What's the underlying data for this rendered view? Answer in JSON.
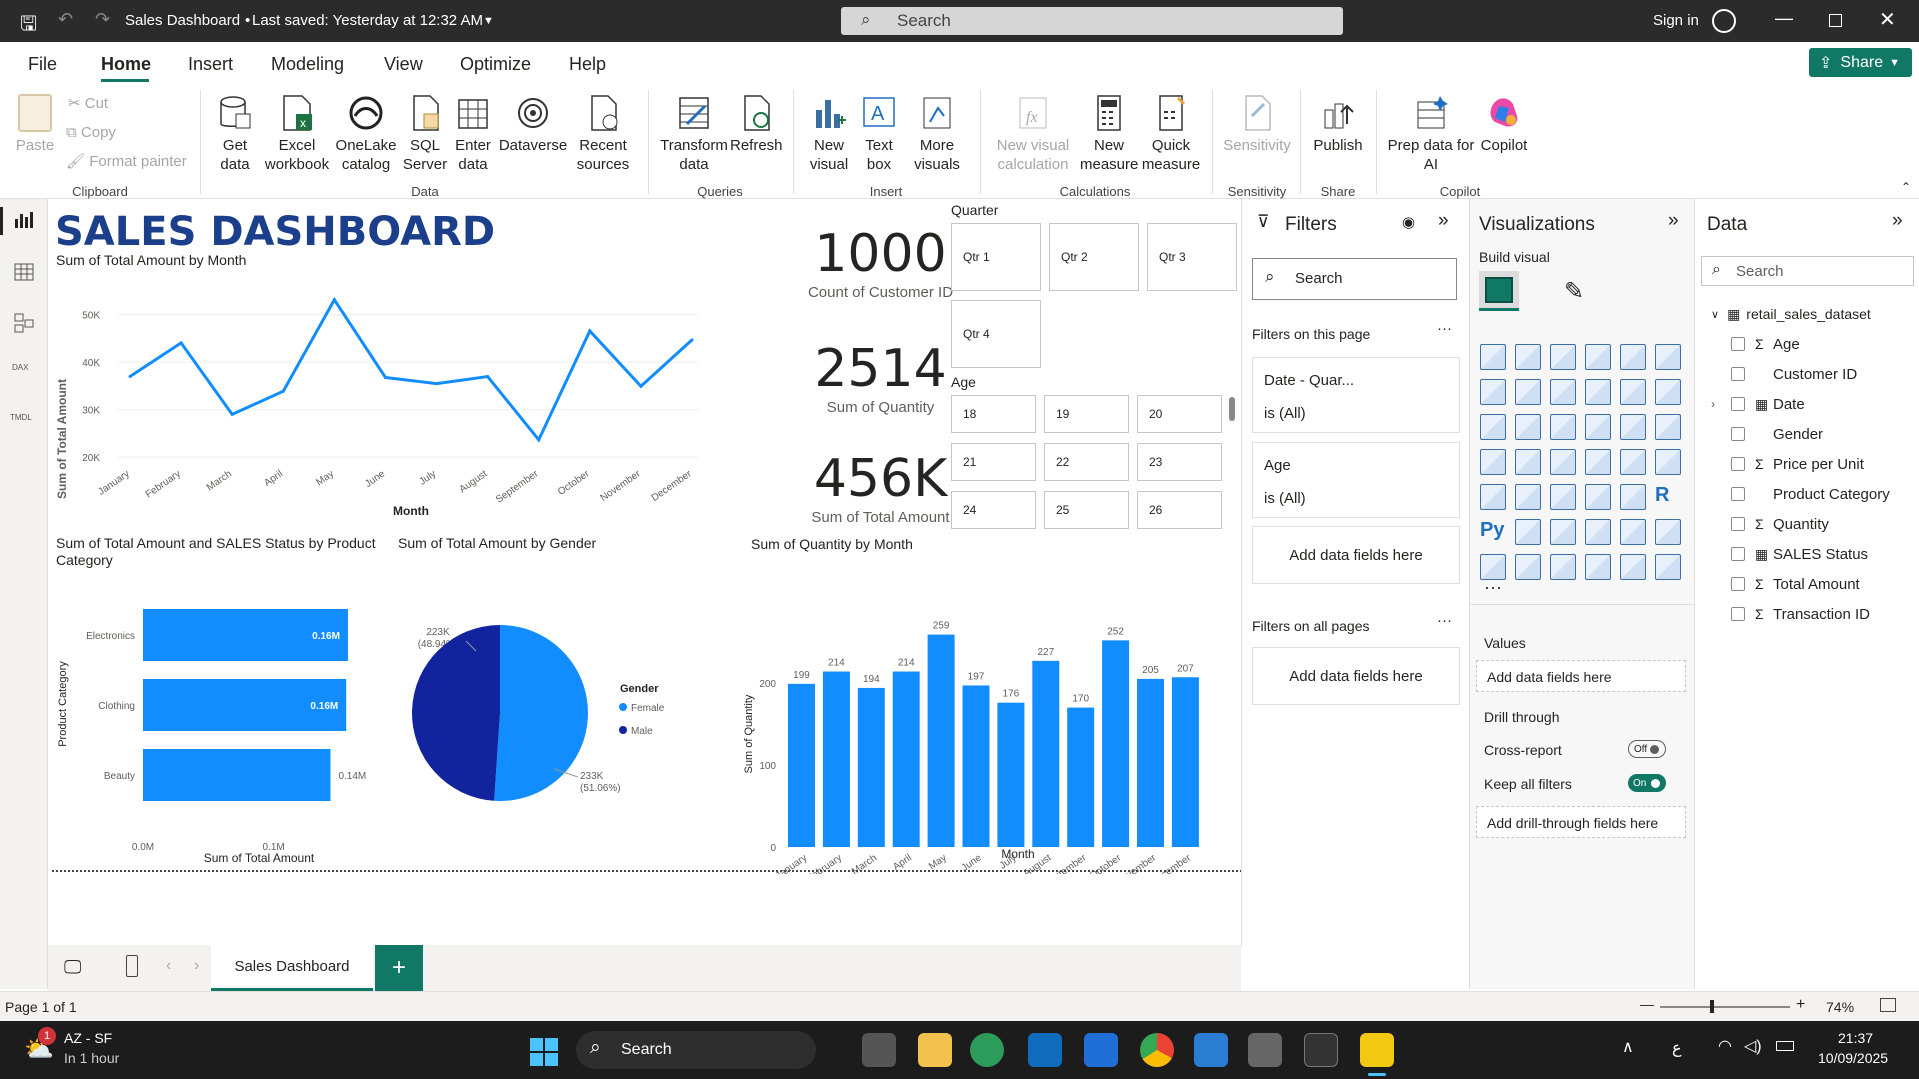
{
  "titlebar": {
    "title": "Sales Dashboard",
    "saved": "Last saved: Yesterday at 12:32 AM",
    "search": "Search",
    "signin": "Sign in"
  },
  "menu": {
    "items": [
      "File",
      "Home",
      "Insert",
      "Modeling",
      "View",
      "Optimize",
      "Help"
    ],
    "share": "Share"
  },
  "ribbon": {
    "clipboard": {
      "paste": "Paste",
      "cut": "Cut",
      "copy": "Copy",
      "format": "Format painter",
      "group": "Clipboard"
    },
    "data": {
      "get": "Get data",
      "excel": "Excel workbook",
      "onelake": "OneLake catalog",
      "sql": "SQL Server",
      "enter": "Enter data",
      "dataverse": "Dataverse",
      "recent": "Recent sources",
      "group": "Data"
    },
    "queries": {
      "transform": "Transform data",
      "refresh": "Refresh",
      "group": "Queries"
    },
    "insert": {
      "newvisual": "New visual",
      "textbox": "Text box",
      "morevisuals": "More visuals",
      "group": "Insert"
    },
    "calc": {
      "newcalc": "New visual calculation",
      "newmeasure": "New measure",
      "quick": "Quick measure",
      "group": "Calculations"
    },
    "sens": {
      "label": "Sensitivity",
      "group": "Sensitivity"
    },
    "share": {
      "publish": "Publish",
      "group": "Share"
    },
    "copilot": {
      "prep": "Prep data for AI",
      "copilot": "Copilot",
      "group": "Copilot"
    }
  },
  "dashboard": {
    "title": "SALES DASHBOARD",
    "line": {
      "title": "Sum of Total Amount by Month",
      "ylabel": "Sum of Total Amount",
      "xlabel": "Month"
    },
    "kpis": [
      {
        "value": "1000",
        "label": "Count of Customer ID"
      },
      {
        "value": "2514",
        "label": "Sum of Quantity"
      },
      {
        "value": "456K",
        "label": "Sum of Total Amount"
      }
    ],
    "quarter": {
      "title": "Quarter",
      "items": [
        "Qtr 1",
        "Qtr 2",
        "Qtr 3",
        "Qtr 4"
      ]
    },
    "age": {
      "title": "Age",
      "items": [
        "18",
        "19",
        "20",
        "21",
        "22",
        "23",
        "24",
        "25",
        "26"
      ]
    },
    "hbar": {
      "title": "Sum of Total Amount and SALES Status by Product Category",
      "ylabel": "Product Category",
      "xlabel": "Sum of Total Amount"
    },
    "pie": {
      "title": "Sum of Total Amount by Gender",
      "legend_title": "Gender",
      "label_male": "223K",
      "label_male_pct": "(48.94%)",
      "label_female": "233K",
      "label_female_pct": "(51.06%)"
    },
    "vbar": {
      "title": "Sum of Quantity by Month",
      "ylabel": "Sum of Quantity",
      "xlabel": "Month"
    }
  },
  "chart_data": [
    {
      "type": "line",
      "title": "Sum of Total Amount by Month",
      "xlabel": "Month",
      "ylabel": "Sum of Total Amount",
      "categories": [
        "January",
        "February",
        "March",
        "April",
        "May",
        "June",
        "July",
        "August",
        "September",
        "October",
        "November",
        "December"
      ],
      "values": [
        36980,
        44060,
        28990,
        33870,
        53150,
        36770,
        35465,
        36960,
        23620,
        46580,
        34920,
        44690
      ],
      "yticks": [
        "20K",
        "30K",
        "40K",
        "50K"
      ],
      "ylim": [
        20000,
        55000
      ]
    },
    {
      "type": "bar",
      "orientation": "horizontal",
      "title": "Sum of Total Amount and SALES Status by Product Category",
      "xlabel": "Sum of Total Amount",
      "ylabel": "Product Category",
      "categories": [
        "Electronics",
        "Clothing",
        "Beauty"
      ],
      "values": [
        156905,
        155580,
        143515
      ],
      "data_labels": [
        "0.16M",
        "0.16M",
        "0.14M"
      ],
      "xticks": [
        "0.0M",
        "0.1M"
      ],
      "xlim": [
        0,
        0.2
      ]
    },
    {
      "type": "pie",
      "title": "Sum of Total Amount by Gender",
      "series": [
        {
          "name": "Female",
          "value": 232840,
          "label": "233K",
          "pct": "(51.06%)",
          "color": "#118DFF"
        },
        {
          "name": "Male",
          "value": 223160,
          "label": "223K",
          "pct": "(48.94%)",
          "color": "#12239E"
        }
      ]
    },
    {
      "type": "bar",
      "title": "Sum of Quantity by Month",
      "xlabel": "Month",
      "ylabel": "Sum of Quantity",
      "categories": [
        "January",
        "February",
        "March",
        "April",
        "May",
        "June",
        "July",
        "August",
        "September",
        "October",
        "November",
        "December"
      ],
      "values": [
        199,
        214,
        194,
        214,
        259,
        197,
        176,
        227,
        170,
        252,
        205,
        207
      ],
      "yticks": [
        "0",
        "100",
        "200"
      ],
      "ylim": [
        0,
        270
      ]
    }
  ],
  "filters": {
    "title": "Filters",
    "search": "Search",
    "on_page": "Filters on this page",
    "date_filter": "Date - Quar...",
    "date_value": "is (All)",
    "age_filter": "Age",
    "age_value": "is (All)",
    "add": "Add data fields here",
    "on_all": "Filters on all pages"
  },
  "viz": {
    "title": "Visualizations",
    "build": "Build visual",
    "values": "Values",
    "add_values": "Add data fields here",
    "drill": "Drill through",
    "cross": "Cross-report",
    "cross_state": "Off",
    "keep": "Keep all filters",
    "keep_state": "On",
    "add_drill": "Add drill-through fields here"
  },
  "data": {
    "title": "Data",
    "search": "Search",
    "table": "retail_sales_dataset",
    "fields": [
      {
        "name": "Age",
        "sigma": true
      },
      {
        "name": "Customer ID",
        "sigma": false
      },
      {
        "name": "Date",
        "sigma": false,
        "cal": true
      },
      {
        "name": "Gender",
        "sigma": false
      },
      {
        "name": "Price per Unit",
        "sigma": true
      },
      {
        "name": "Product Category",
        "sigma": false
      },
      {
        "name": "Quantity",
        "sigma": true
      },
      {
        "name": "SALES Status",
        "sigma": false,
        "cal": true
      },
      {
        "name": "Total Amount",
        "sigma": true
      },
      {
        "name": "Transaction ID",
        "sigma": true
      }
    ]
  },
  "tabs": {
    "page": "Sales Dashboard"
  },
  "status": {
    "page": "Page 1 of 1",
    "zoom": "74%"
  },
  "taskbar": {
    "weather_title": "AZ - SF",
    "weather_sub": "In 1 hour",
    "search": "Search",
    "time": "21:37",
    "date": "10/09/2025",
    "notif": "1"
  },
  "colors": {
    "accent": "#118DFF",
    "dark": "#12239E",
    "title": "#1B3F8B"
  }
}
